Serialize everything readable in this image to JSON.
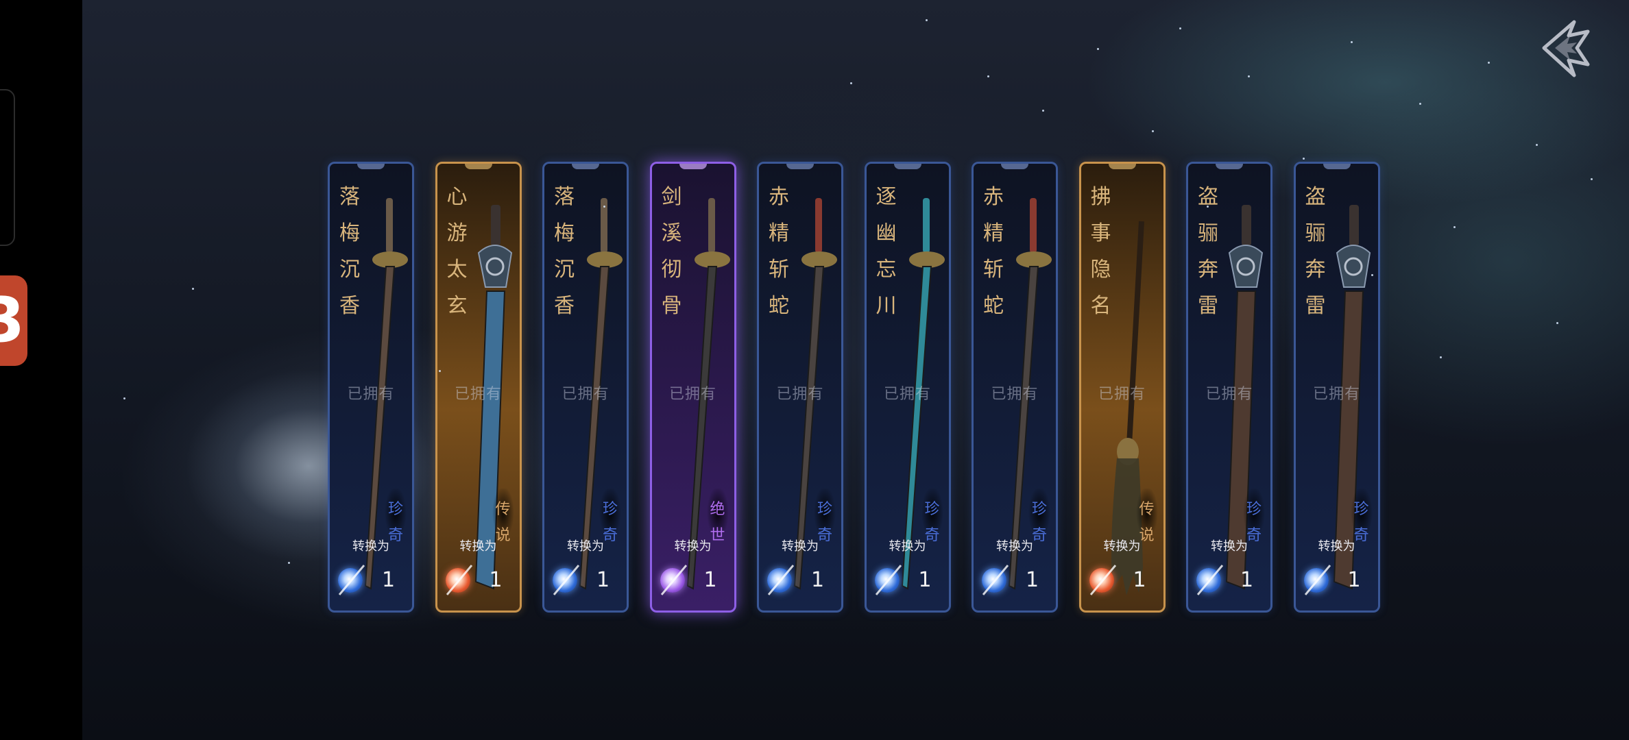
{
  "cards": [
    {
      "name": [
        "落",
        "梅",
        "沉",
        "香"
      ],
      "owned": "已拥有",
      "rarity": [
        "珍",
        "奇"
      ],
      "convert": "转换为",
      "count": "1",
      "tier": "rare",
      "weapon": "sword-bronze-icon",
      "blade": "#5b4a3f"
    },
    {
      "name": [
        "心",
        "游",
        "太",
        "玄"
      ],
      "owned": "已拥有",
      "rarity": [
        "传",
        "说"
      ],
      "convert": "转换为",
      "count": "1",
      "tier": "legend",
      "weapon": "greatsword-blue-icon",
      "blade": "#3e6f96"
    },
    {
      "name": [
        "落",
        "梅",
        "沉",
        "香"
      ],
      "owned": "已拥有",
      "rarity": [
        "珍",
        "奇"
      ],
      "convert": "转换为",
      "count": "1",
      "tier": "rare",
      "weapon": "sword-bronze-icon",
      "blade": "#5b4a3f"
    },
    {
      "name": [
        "剑",
        "溪",
        "彻",
        "骨"
      ],
      "owned": "已拥有",
      "rarity": [
        "绝",
        "世"
      ],
      "convert": "转换为",
      "count": "1",
      "tier": "epic",
      "weapon": "sword-dark-icon",
      "blade": "#3b3a3a"
    },
    {
      "name": [
        "赤",
        "精",
        "斩",
        "蛇"
      ],
      "owned": "已拥有",
      "rarity": [
        "珍",
        "奇"
      ],
      "convert": "转换为",
      "count": "1",
      "tier": "rare",
      "weapon": "sword-red-hilt-icon",
      "blade": "#4a4340"
    },
    {
      "name": [
        "逐",
        "幽",
        "忘",
        "川"
      ],
      "owned": "已拥有",
      "rarity": [
        "珍",
        "奇"
      ],
      "convert": "转换为",
      "count": "1",
      "tier": "rare",
      "weapon": "sword-teal-icon",
      "blade": "#2f8a98"
    },
    {
      "name": [
        "赤",
        "精",
        "斩",
        "蛇"
      ],
      "owned": "已拥有",
      "rarity": [
        "珍",
        "奇"
      ],
      "convert": "转换为",
      "count": "1",
      "tier": "rare",
      "weapon": "sword-red-hilt-icon",
      "blade": "#4a4340"
    },
    {
      "name": [
        "拂",
        "事",
        "隐",
        "名"
      ],
      "owned": "已拥有",
      "rarity": [
        "传",
        "说"
      ],
      "convert": "转换为",
      "count": "1",
      "tier": "legend",
      "weapon": "whisk-icon",
      "blade": "#3d3a28"
    },
    {
      "name": [
        "盗",
        "骊",
        "奔",
        "雷"
      ],
      "owned": "已拥有",
      "rarity": [
        "珍",
        "奇"
      ],
      "convert": "转换为",
      "count": "1",
      "tier": "rare",
      "weapon": "greatsword-brown-icon",
      "blade": "#4e3a30"
    },
    {
      "name": [
        "盗",
        "骊",
        "奔",
        "雷"
      ],
      "owned": "已拥有",
      "rarity": [
        "珍",
        "奇"
      ],
      "convert": "转换为",
      "count": "1",
      "tier": "rare",
      "weapon": "greatsword-brown-icon",
      "blade": "#4e3a30"
    }
  ],
  "icons": {
    "back": "back-arrow-icon",
    "gem": "spirit-gem-icon"
  },
  "colors": {
    "rare": "#3a5796",
    "legend": "#c8934c",
    "epic": "#8e5fe6",
    "name_text": "#d9b57c"
  }
}
